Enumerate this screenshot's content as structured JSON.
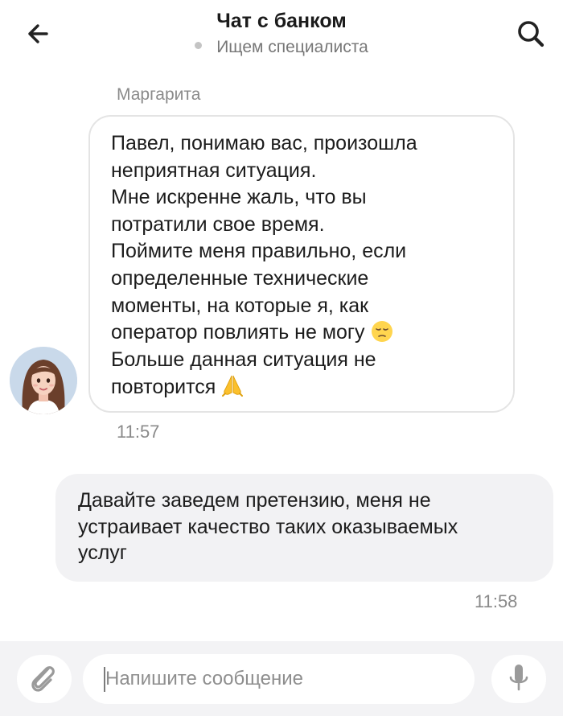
{
  "header": {
    "title": "Чат с банком",
    "status": "Ищем специалиста",
    "back_icon": "arrow-left-icon",
    "search_icon": "search-icon"
  },
  "messages": [
    {
      "direction": "incoming",
      "sender": "Маргарита",
      "lines": [
        "Павел, понимаю вас, произошла",
        "неприятная ситуация.",
        "Мне искренне жаль, что вы",
        "потратили свое время.",
        "Поймите меня правильно, если",
        "определенные технические",
        "моменты, на которые я, как",
        "оператор повлиять не могу",
        "Больше данная ситуация не",
        "повторится"
      ],
      "emoji": [
        "pensive-face-emoji",
        "folded-hands-emoji"
      ],
      "time": "11:57"
    },
    {
      "direction": "outgoing",
      "lines": [
        "Давайте заведем претензию, меня не",
        "устраивает качество таких оказываемых",
        "услуг"
      ],
      "time": "11:58"
    }
  ],
  "composer": {
    "placeholder": "Напишите сообщение",
    "value": "",
    "attach_icon": "paperclip-icon",
    "mic_icon": "microphone-icon"
  },
  "colors": {
    "outgoing_bubble": "#f2f2f4",
    "incoming_border": "#e4e4e4",
    "muted_text": "#8a8a8a",
    "bottom_bar": "#f3f3f5"
  }
}
